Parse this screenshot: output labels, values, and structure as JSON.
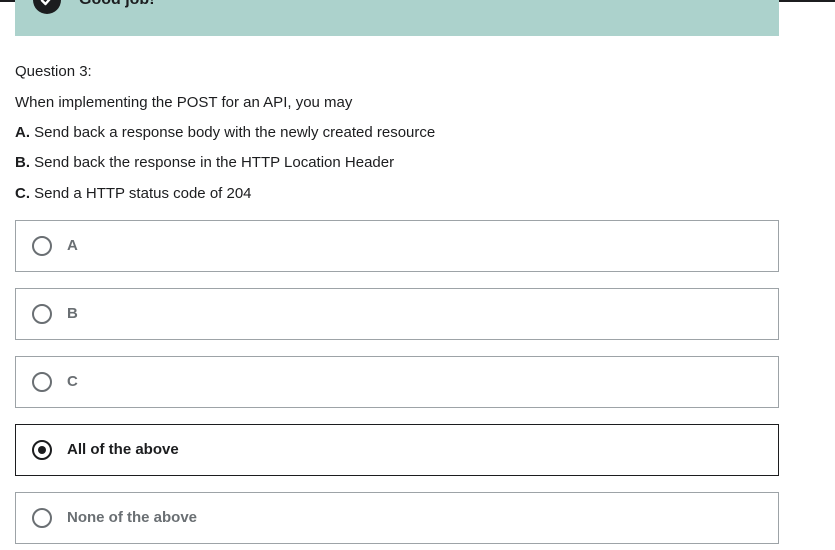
{
  "feedback": {
    "title": "Good job!",
    "icon": "checkmark-icon",
    "background_color": "#acd2cc"
  },
  "question": {
    "number_label": "Question 3:",
    "prompt": "When implementing the POST for an API, you may",
    "statements": [
      {
        "letter": "A.",
        "text": " Send back a response body with the newly created resource"
      },
      {
        "letter": "B.",
        "text": " Send back the response in the HTTP Location Header"
      },
      {
        "letter": "C.",
        "text": " Send a HTTP status code of 204"
      }
    ]
  },
  "options": [
    {
      "label": "A",
      "selected": false
    },
    {
      "label": "B",
      "selected": false
    },
    {
      "label": "C",
      "selected": false
    },
    {
      "label": "All of the above",
      "selected": true
    },
    {
      "label": "None of the above",
      "selected": false
    }
  ]
}
